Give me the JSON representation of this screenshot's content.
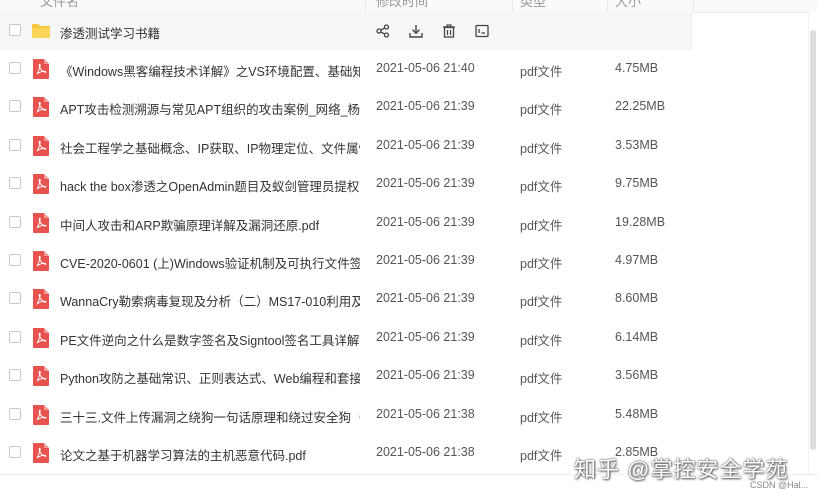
{
  "header": {
    "col_name": "文件名",
    "col_date": "修改时间",
    "col_type": "类型",
    "col_size": "大小"
  },
  "folder": {
    "name": "渗透测试学习书籍",
    "actions": [
      "share-icon",
      "download-icon",
      "delete-icon",
      "more-icon"
    ]
  },
  "files": [
    {
      "name": "《Windows黑客编程技术详解》之VS环境配置、基础知...",
      "date": "2021-05-06 21:40",
      "type": "pdf文件",
      "size": "4.75MB"
    },
    {
      "name": "APT攻击检测溯源与常见APT组织的攻击案例_网络_杨秀...",
      "date": "2021-05-06 21:39",
      "type": "pdf文件",
      "size": "22.25MB"
    },
    {
      "name": "社会工程学之基础概念、IP获取、IP物理定位、文件属性...",
      "date": "2021-05-06 21:39",
      "type": "pdf文件",
      "size": "3.53MB"
    },
    {
      "name": "hack the box渗透之OpenAdmin题目及蚁剑管理员提权...",
      "date": "2021-05-06 21:39",
      "type": "pdf文件",
      "size": "9.75MB"
    },
    {
      "name": "中间人攻击和ARP欺骗原理详解及漏洞还原.pdf",
      "date": "2021-05-06 21:39",
      "type": "pdf文件",
      "size": "19.28MB"
    },
    {
      "name": "CVE-2020-0601 (上)Windows验证机制及可执行文件签...",
      "date": "2021-05-06 21:39",
      "type": "pdf文件",
      "size": "4.97MB"
    },
    {
      "name": "WannaCry勒索病毒复现及分析（二）MS17-010利用及...",
      "date": "2021-05-06 21:39",
      "type": "pdf文件",
      "size": "8.60MB"
    },
    {
      "name": "PE文件逆向之什么是数字签名及Signtool签名工具详解（...",
      "date": "2021-05-06 21:39",
      "type": "pdf文件",
      "size": "6.14MB"
    },
    {
      "name": "Python攻防之基础常识、正则表达式、Web编程和套接...",
      "date": "2021-05-06 21:39",
      "type": "pdf文件",
      "size": "3.56MB"
    },
    {
      "name": "三十三.文件上传漏洞之绕狗一句话原理和绕过安全狗（六...",
      "date": "2021-05-06 21:38",
      "type": "pdf文件",
      "size": "5.48MB"
    },
    {
      "name": "论文之基于机器学习算法的主机恶意代码.pdf",
      "date": "2021-05-06 21:38",
      "type": "pdf文件",
      "size": "2.85MB"
    }
  ],
  "watermark": "知乎 @掌控安全学苑",
  "csdn_tag": "CSDN @Hal...",
  "colors": {
    "pdf_red": "#e8534f",
    "folder_yellow": "#f8c63d"
  }
}
